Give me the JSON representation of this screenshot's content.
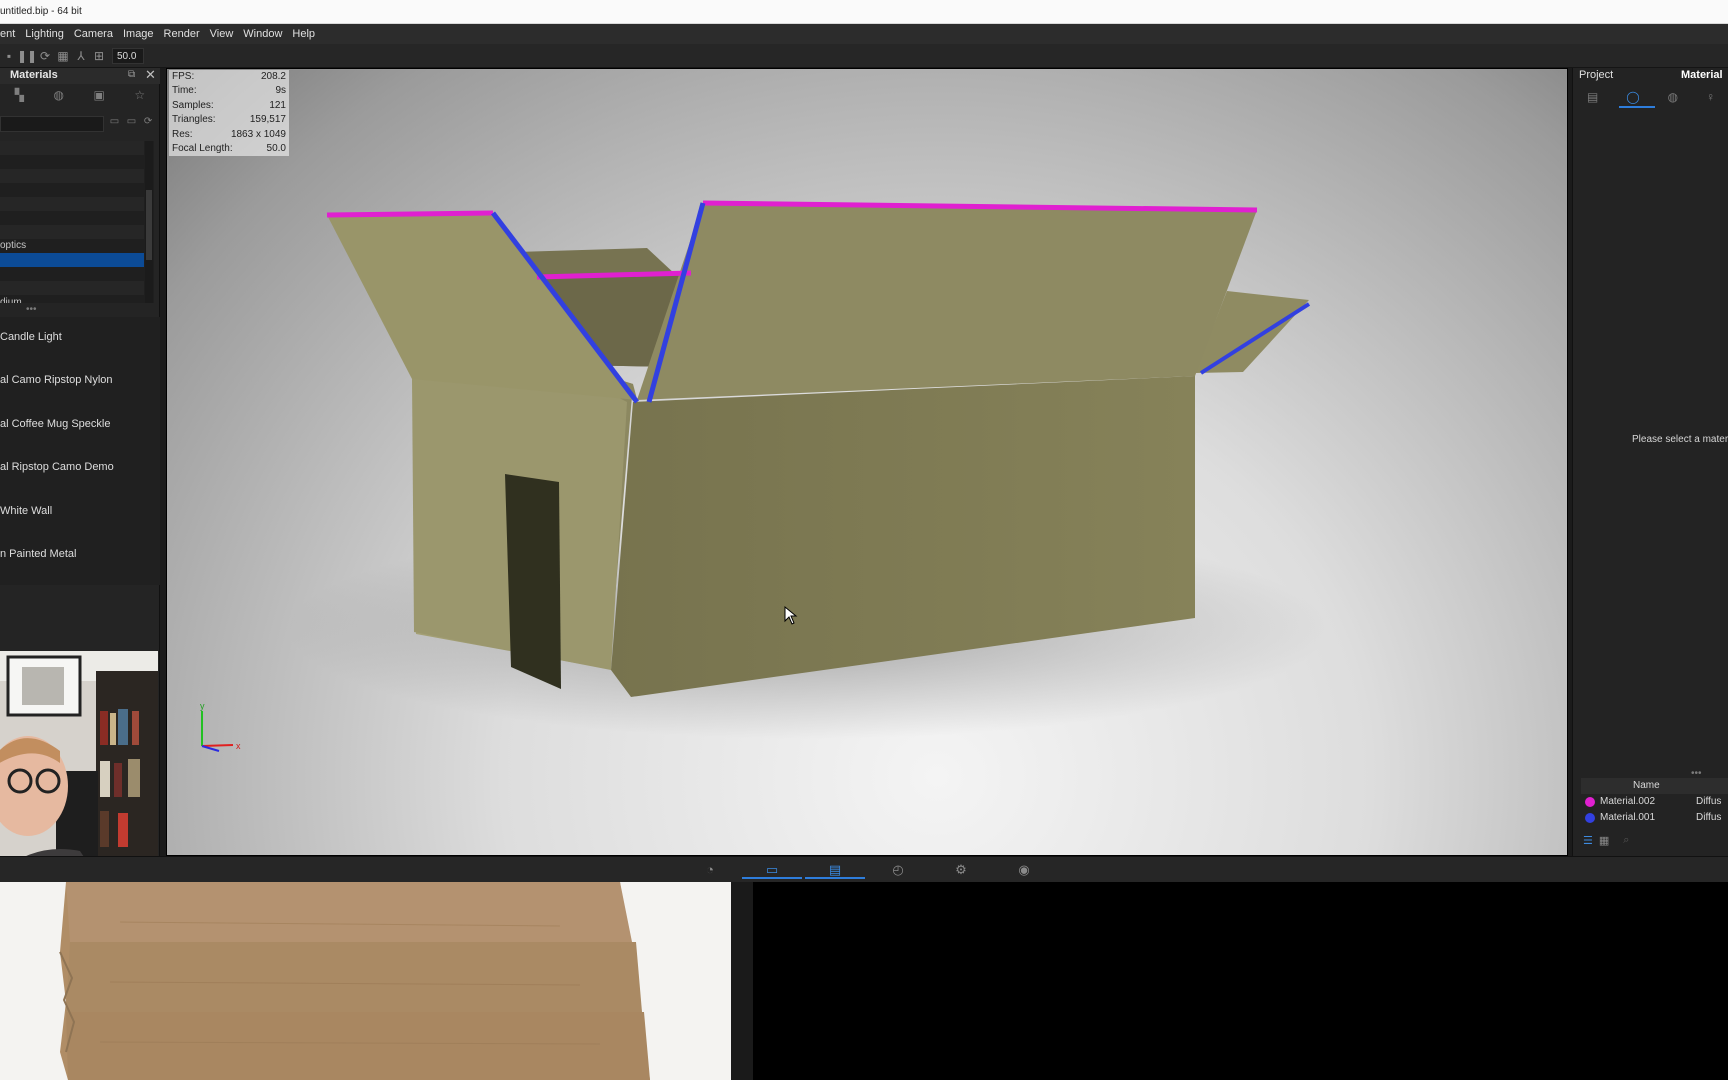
{
  "window": {
    "title": "untitled.bip - 64 bit"
  },
  "menu": [
    "ent",
    "Lighting",
    "Camera",
    "Image",
    "Render",
    "View",
    "Window",
    "Help"
  ],
  "toolbar": {
    "field_value": "50.0"
  },
  "left_panel": {
    "title": "Materials",
    "tree_rows": [
      "",
      "",
      "",
      "",
      "",
      "",
      "",
      "optics",
      "",
      "",
      "",
      "dium"
    ],
    "materials": [
      "Candle Light",
      "al Camo Ripstop Nylon",
      "al Coffee Mug Speckle",
      "al Ripstop Camo Demo",
      "White Wall",
      "n Painted Metal"
    ]
  },
  "viewport": {
    "stats": [
      {
        "label": "FPS:",
        "value": "208.2"
      },
      {
        "label": "Time:",
        "value": "9s"
      },
      {
        "label": "Samples:",
        "value": "121"
      },
      {
        "label": "Triangles:",
        "value": "159,517"
      },
      {
        "label": "Res:",
        "value": "1863 x 1049"
      },
      {
        "label": "Focal Length:",
        "value": "50.0"
      }
    ],
    "axis_y": "y",
    "axis_x": "x"
  },
  "right_panel": {
    "project_label": "Project",
    "material_label": "Material",
    "hint": "Please select a materia",
    "table_header": "Name",
    "rows": [
      {
        "name": "Material.002",
        "type": "Diffus",
        "color": "#e020d0"
      },
      {
        "name": "Material.001",
        "type": "Diffus",
        "color": "#3240e0"
      }
    ]
  },
  "colors": {
    "accent": "#2e7ddb",
    "selection": "#0c4b96",
    "box_edge_magenta": "#e020d0",
    "box_edge_blue": "#3240e0",
    "box_surface": "#8c8760"
  }
}
